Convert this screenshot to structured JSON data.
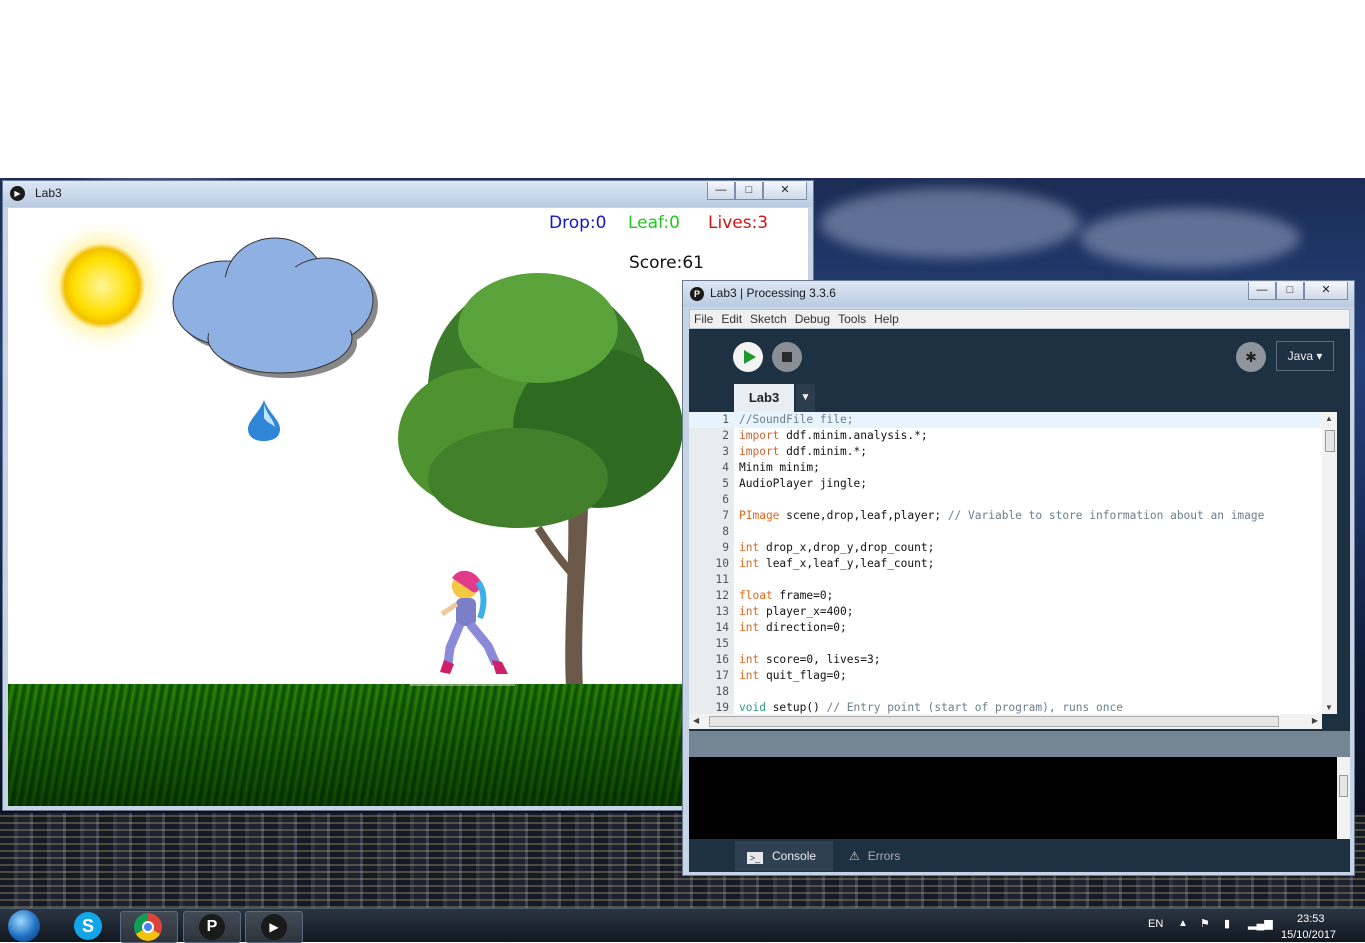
{
  "game_window": {
    "title": "Lab3",
    "controls": {
      "minimize": "—",
      "maximize": "□",
      "close": "✕"
    },
    "hud": {
      "drop": "Drop:0",
      "leaf": "Leaf:0",
      "lives": "Lives:3",
      "score": "Score:61",
      "colors": {
        "drop": "#1414c8",
        "leaf": "#22c81e",
        "lives": "#d41414",
        "score": "#111111"
      }
    }
  },
  "ide_window": {
    "title": "Lab3 | Processing 3.3.6",
    "menu": [
      "File",
      "Edit",
      "Sketch",
      "Debug",
      "Tools",
      "Help"
    ],
    "mode": "Java ▾",
    "tab": "Lab3",
    "tab_arrow": "▼",
    "code": [
      {
        "n": "1",
        "text": "//SoundFile file;"
      },
      {
        "n": "2",
        "text": "import ddf.minim.analysis.*;"
      },
      {
        "n": "3",
        "text": "import ddf.minim.*;"
      },
      {
        "n": "4",
        "text": "Minim minim;"
      },
      {
        "n": "5",
        "text": "AudioPlayer jingle;"
      },
      {
        "n": "6",
        "text": ""
      },
      {
        "n": "7",
        "text": "PImage scene,drop,leaf,player; // Variable to store information about an image"
      },
      {
        "n": "8",
        "text": ""
      },
      {
        "n": "9",
        "text": "int drop_x,drop_y,drop_count;"
      },
      {
        "n": "10",
        "text": "int leaf_x,leaf_y,leaf_count;"
      },
      {
        "n": "11",
        "text": ""
      },
      {
        "n": "12",
        "text": "float frame=0;"
      },
      {
        "n": "13",
        "text": "int player_x=400;"
      },
      {
        "n": "14",
        "text": "int direction=0;"
      },
      {
        "n": "15",
        "text": ""
      },
      {
        "n": "16",
        "text": "int score=0, lives=3;"
      },
      {
        "n": "17",
        "text": "int quit_flag=0;"
      },
      {
        "n": "18",
        "text": ""
      },
      {
        "n": "19",
        "text": "void setup() // Entry point (start of program), runs once"
      }
    ],
    "console_tabs": {
      "console": "Console",
      "errors": "Errors"
    }
  },
  "taskbar": {
    "language": "EN",
    "time": "23:53",
    "date": "15/10/2017"
  }
}
